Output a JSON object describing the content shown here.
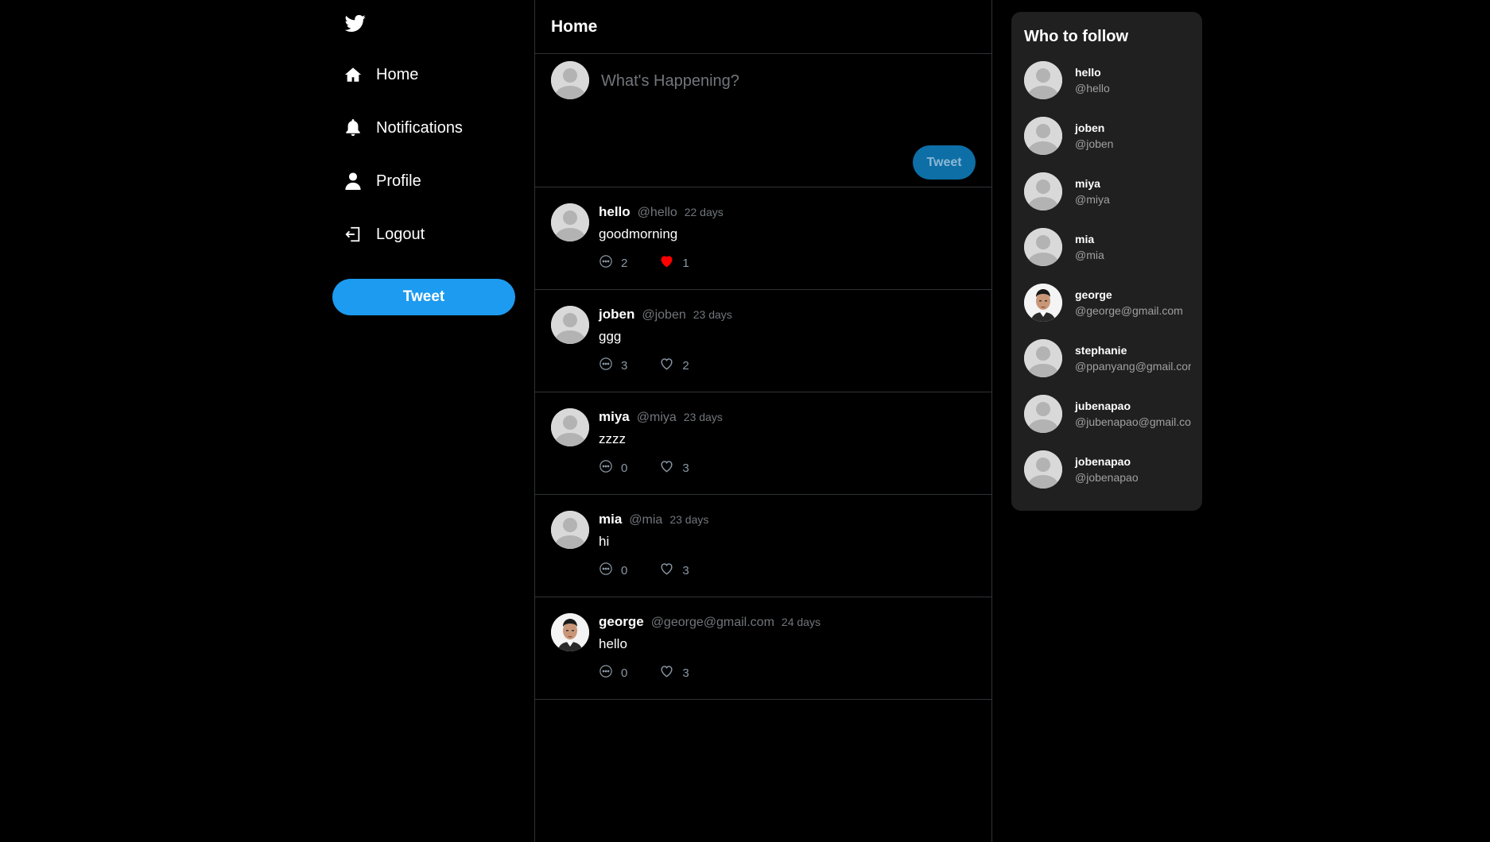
{
  "sidebar": {
    "logo": "twitter-bird-icon",
    "nav": [
      {
        "label": "Home",
        "icon": "home-icon"
      },
      {
        "label": "Notifications",
        "icon": "bell-icon"
      },
      {
        "label": "Profile",
        "icon": "person-icon"
      },
      {
        "label": "Logout",
        "icon": "logout-icon"
      }
    ],
    "tweet_label": "Tweet"
  },
  "feed": {
    "title": "Home",
    "composer": {
      "placeholder": "What's Happening?",
      "tweet_label": "Tweet"
    },
    "posts": [
      {
        "name": "hello",
        "handle": "@hello",
        "time": "22 days",
        "text": "goodmorning",
        "replies": "2",
        "likes": "1",
        "liked": true,
        "avatar": "default"
      },
      {
        "name": "joben",
        "handle": "@joben",
        "time": "23 days",
        "text": "ggg",
        "replies": "3",
        "likes": "2",
        "liked": false,
        "avatar": "default"
      },
      {
        "name": "miya",
        "handle": "@miya",
        "time": "23 days",
        "text": "zzzz",
        "replies": "0",
        "likes": "3",
        "liked": false,
        "avatar": "default"
      },
      {
        "name": "mia",
        "handle": "@mia",
        "time": "23 days",
        "text": "hi",
        "replies": "0",
        "likes": "3",
        "liked": false,
        "avatar": "default"
      },
      {
        "name": "george",
        "handle": "@george@gmail.com",
        "time": "24 days",
        "text": "hello",
        "replies": "0",
        "likes": "3",
        "liked": false,
        "avatar": "photo"
      }
    ]
  },
  "who_to_follow": {
    "title": "Who to follow",
    "users": [
      {
        "name": "hello",
        "handle": "@hello",
        "avatar": "default"
      },
      {
        "name": "joben",
        "handle": "@joben",
        "avatar": "default"
      },
      {
        "name": "miya",
        "handle": "@miya",
        "avatar": "default"
      },
      {
        "name": "mia",
        "handle": "@mia",
        "avatar": "default"
      },
      {
        "name": "george",
        "handle": "@george@gmail.com",
        "avatar": "photo"
      },
      {
        "name": "stephanie",
        "handle": "@ppanyang@gmail.com",
        "avatar": "default"
      },
      {
        "name": "jubenapao",
        "handle": "@jubenapao@gmail.com",
        "avatar": "default"
      },
      {
        "name": "jobenapao",
        "handle": "@jobenapao",
        "avatar": "default"
      }
    ]
  },
  "colors": {
    "accent": "#1d9bf0",
    "like_active": "#f91880",
    "background": "#000000",
    "panel": "#202020"
  }
}
